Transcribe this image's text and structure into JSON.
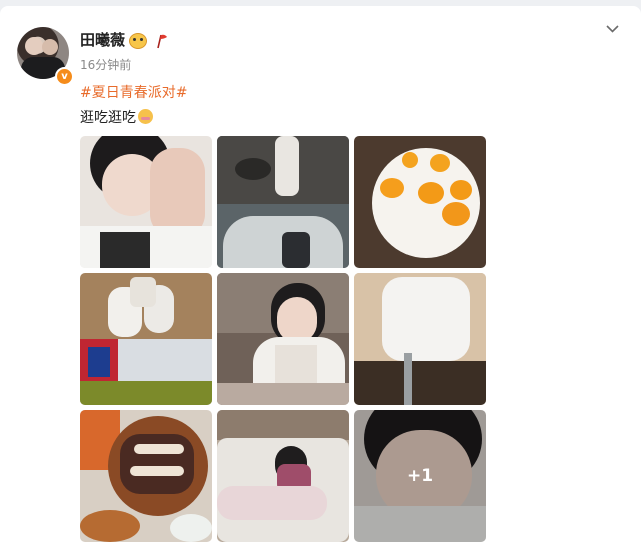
{
  "post": {
    "username": "田曦薇",
    "time": "16分钟前",
    "topic": "#夏日青春派对#",
    "text": "逛吃逛吃",
    "more_count": "+1"
  },
  "icons": {
    "verified": "verified-badge-icon",
    "badge": "emoji-badge-icon",
    "flag": "flag-icon",
    "more": "chevron-down-icon",
    "text_emoji": "laughing-emoji-icon"
  },
  "colors": {
    "topic": "#e86b2b",
    "verified": "#f58c1b",
    "username": "#222222",
    "time": "#8a8a8a"
  },
  "photos": [
    "selfie-hand-on-face",
    "street-and-phone-camera",
    "fried-eggs",
    "white-shoes-and-bag",
    "eating-with-chopsticks",
    "shirt-and-flask",
    "grilled-ribs-dish",
    "lying-on-sofa",
    "close-up-selfie"
  ]
}
